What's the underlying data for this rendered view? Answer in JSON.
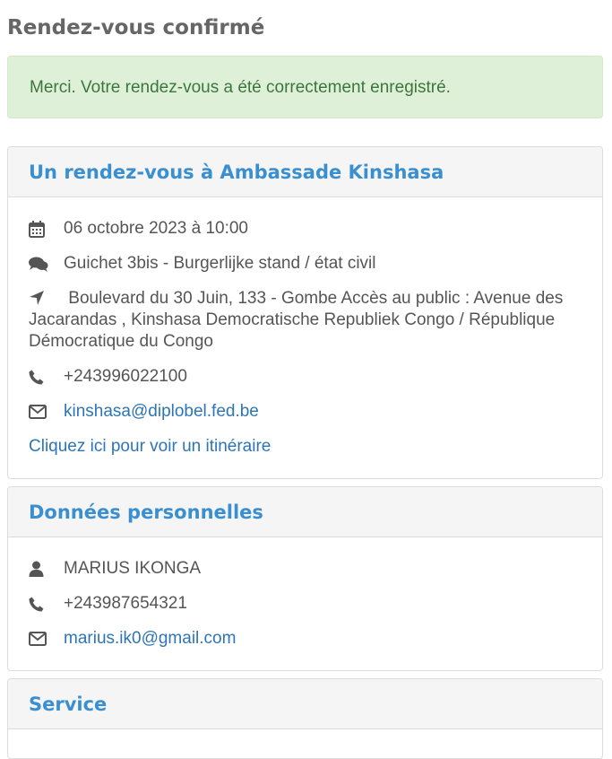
{
  "page_title": "Rendez-vous confirmé",
  "alert": {
    "text": "Merci. Votre rendez-vous a été correctement enregistré."
  },
  "appointment": {
    "title": "Un rendez-vous à Ambassade Kinshasa",
    "datetime": "06 octobre 2023 à 10:00",
    "counter": "Guichet 3bis - Burgerlijke stand / état civil",
    "address": "Boulevard du 30 Juin, 133 - Gombe Accès au public : Avenue des Jacarandas , Kinshasa Democratische Republiek Congo / République Démocratique du Congo",
    "phone": "+243996022100",
    "email": "kinshasa@diplobel.fed.be",
    "itinerary_link": "Cliquez ici pour voir un itinéraire",
    "icons": [
      "calendar-icon",
      "comments-icon",
      "location-arrow-icon",
      "phone-icon",
      "envelope-icon"
    ]
  },
  "personal": {
    "title": "Données personnelles",
    "name": "MARIUS IKONGA",
    "phone": "+243987654321",
    "email": "marius.ik0@gmail.com",
    "icons": [
      "user-icon",
      "phone-icon",
      "envelope-icon"
    ]
  },
  "service": {
    "title": "Service"
  },
  "colors": {
    "alert_bg": "#dff0d8",
    "alert_text": "#3c763d",
    "panel_title": "#3a8fd0",
    "link": "#2e75b6",
    "panel_heading_bg": "#f5f5f5"
  }
}
